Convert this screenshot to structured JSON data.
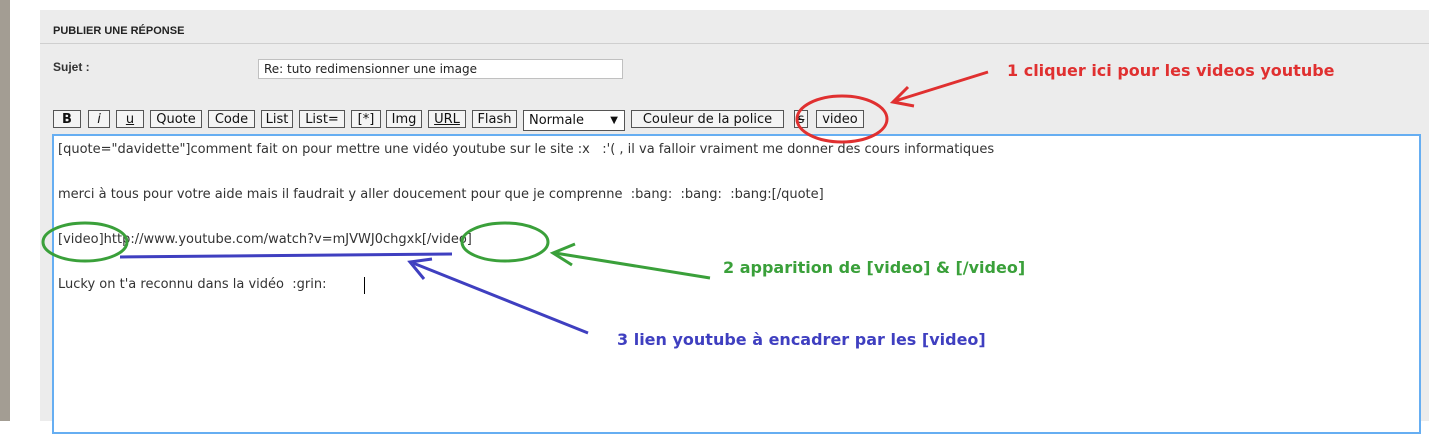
{
  "panel": {
    "title": "PUBLIER UNE RÉPONSE",
    "subject_label": "Sujet :",
    "subject_value": "Re: tuto redimensionner une image"
  },
  "toolbar": {
    "bold": "B",
    "italic": "i",
    "underline": "u",
    "quote": "Quote",
    "code": "Code",
    "list": "List",
    "list_eq": "List=",
    "list_item": "[*]",
    "img": "Img",
    "url": "URL",
    "flash": "Flash",
    "size_select": "Normale",
    "font_color": "Couleur de la police",
    "strike": "s",
    "video": "video"
  },
  "editor": {
    "lines": [
      "[quote=\"davidette\"]comment fait on pour mettre une vidéo youtube sur le site :x   :'( , il va falloir vraiment me donner des cours informatiques",
      "merci à tous pour votre aide mais il faudrait y aller doucement pour que je comprenne  :bang:  :bang:  :bang:[/quote]",
      "[video]http://www.youtube.com/watch?v=mJVWJ0chgxk[/video]",
      "Lucky on t'a reconnu dans la vidéo  :grin: "
    ]
  },
  "annotations": {
    "step1": "1 cliquer ici pour les videos youtube",
    "step2": "2 apparition de [video] & [/video]",
    "step3": "3 lien youtube à encadrer par les [video]"
  },
  "colors": {
    "red": "#e03030",
    "green": "#3aa03a",
    "blue": "#3f3fc0",
    "editor_border": "#66aef2"
  }
}
